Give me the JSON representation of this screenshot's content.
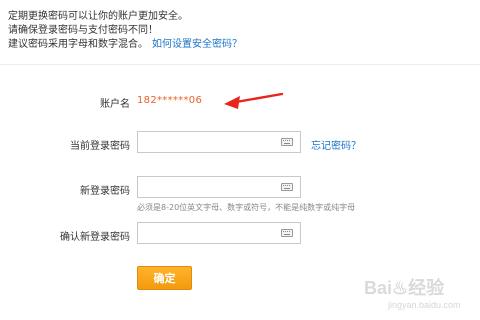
{
  "tips": {
    "line1": "定期更换密码可以让你的账户更加安全。",
    "line2": "请确保登录密码与支付密码不同！",
    "line3": "建议密码采用字母和数字混合。",
    "link": "如何设置安全密码？"
  },
  "account": {
    "label": "账户名",
    "value": "182******06"
  },
  "fields": {
    "current_label": "当前登录密码",
    "current_value": "",
    "forgot_link": "忘记密码？",
    "new_label": "新登录密码",
    "new_value": "",
    "new_hint": "必须是8-20位英文字母、数字或符号，不能是纯数字或纯字母",
    "confirm_label": "确认新登录密码",
    "confirm_value": ""
  },
  "submit_label": "确定",
  "watermark": {
    "text": "Bai♨经验",
    "sub": "jingyan.baidu.com"
  },
  "colors": {
    "accent_orange": "#f39a0e",
    "account_value": "#e8632a",
    "link_blue": "#1a74c7",
    "arrow_red": "#e8241b"
  },
  "icons": {
    "keyboard": "keyboard-icon",
    "arrow": "red-arrow-icon"
  }
}
